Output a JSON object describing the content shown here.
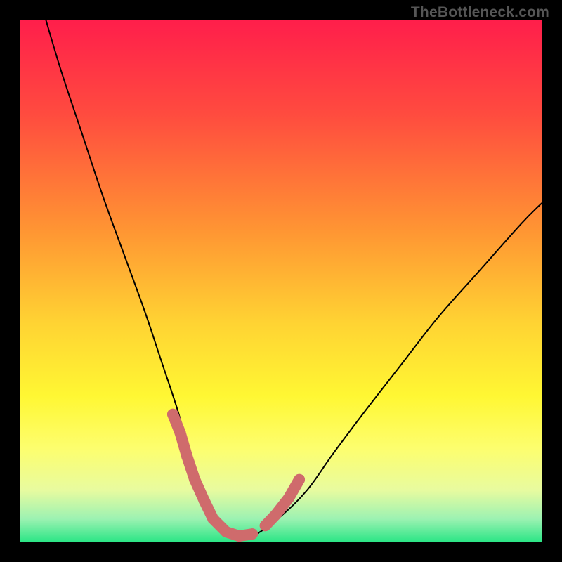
{
  "watermark": "TheBottleneck.com",
  "colors": {
    "frame": "#000000",
    "curve": "#000000",
    "marker_fill": "#CF6B6C",
    "marker_stroke": "#CF6B6C",
    "gradient_stops": [
      {
        "offset": 0.0,
        "color": "#FF1E4B"
      },
      {
        "offset": 0.18,
        "color": "#FF4B3F"
      },
      {
        "offset": 0.4,
        "color": "#FF9433"
      },
      {
        "offset": 0.58,
        "color": "#FFD333"
      },
      {
        "offset": 0.72,
        "color": "#FFF733"
      },
      {
        "offset": 0.82,
        "color": "#FDFE6E"
      },
      {
        "offset": 0.9,
        "color": "#E8FB9F"
      },
      {
        "offset": 0.955,
        "color": "#9CF2B2"
      },
      {
        "offset": 1.0,
        "color": "#29E585"
      }
    ]
  },
  "chart_data": {
    "type": "line",
    "title": "",
    "xlabel": "",
    "ylabel": "",
    "xlim": [
      0,
      100
    ],
    "ylim": [
      0,
      100
    ],
    "series": [
      {
        "name": "bottleneck-curve",
        "x": [
          5,
          8,
          12,
          16,
          20,
          24,
          27,
          30,
          32,
          34,
          36,
          38,
          40,
          43,
          46,
          50,
          55,
          60,
          66,
          73,
          80,
          88,
          96,
          100
        ],
        "y": [
          100,
          90,
          78,
          66,
          55,
          44,
          35,
          26,
          19,
          13,
          8,
          4,
          2,
          1,
          2,
          5,
          10,
          17,
          25,
          34,
          43,
          52,
          61,
          65
        ]
      }
    ],
    "highlight_segments": [
      {
        "name": "left-arm-markers",
        "points": [
          {
            "x": 29.3,
            "y": 24.5
          },
          {
            "x": 30.7,
            "y": 21.0
          },
          {
            "x": 32.0,
            "y": 16.5
          },
          {
            "x": 33.5,
            "y": 12.0
          },
          {
            "x": 35.3,
            "y": 8.0
          },
          {
            "x": 37.0,
            "y": 4.5
          },
          {
            "x": 39.5,
            "y": 2.0
          },
          {
            "x": 42.0,
            "y": 1.2
          },
          {
            "x": 44.5,
            "y": 1.6
          }
        ]
      },
      {
        "name": "right-arm-markers",
        "points": [
          {
            "x": 47.0,
            "y": 3.2
          },
          {
            "x": 49.0,
            "y": 5.3
          },
          {
            "x": 51.5,
            "y": 8.5
          },
          {
            "x": 53.5,
            "y": 12.0
          }
        ]
      }
    ]
  }
}
